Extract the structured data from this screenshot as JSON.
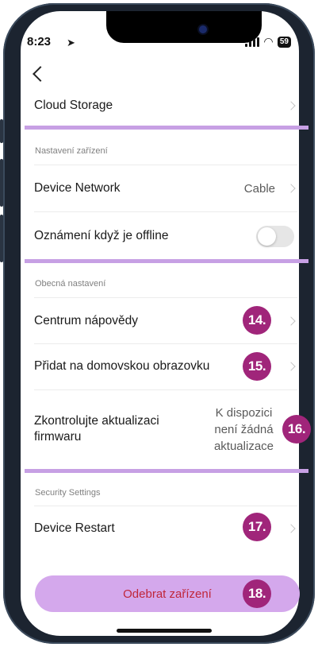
{
  "status_bar": {
    "time": "8:23",
    "battery": "59"
  },
  "header": {
    "back_icon": "chevron-left-icon"
  },
  "rows": {
    "cloud_storage": {
      "label": "Cloud Storage"
    },
    "device_network": {
      "label": "Device Network",
      "value": "Cable"
    },
    "offline_notification": {
      "label": "Oznámení když je offline",
      "toggle_on": false
    },
    "help_center": {
      "label": "Centrum nápovědy"
    },
    "add_to_home": {
      "label": "Přidat na domovskou obrazovku"
    },
    "firmware": {
      "label_line1": "Zkontrolujte aktualizaci",
      "label_line2": "firmwaru",
      "value_line1": "K dispozici",
      "value_line2": "není žádná",
      "value_line3": "aktualizace"
    },
    "device_restart": {
      "label": "Device Restart"
    }
  },
  "sections": {
    "device_settings": "Nastavení zařízení",
    "general_settings": "Obecná nastavení",
    "security_settings": "Security Settings"
  },
  "remove_button": {
    "label": "Odebrat zařízení"
  },
  "badges": {
    "b14": "14.",
    "b15": "15.",
    "b16": "16.",
    "b17": "17.",
    "b18": "18."
  },
  "colors": {
    "accent_line": "#c7a0e4",
    "badge": "#a0257a",
    "remove_button_bg": "#d4a8ec",
    "remove_button_text": "#c0263a"
  }
}
